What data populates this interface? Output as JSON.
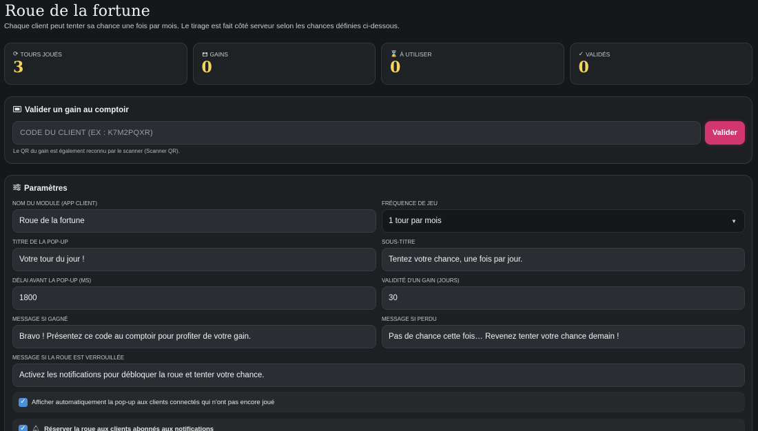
{
  "header": {
    "title": "Roue de la fortune",
    "subtitle": "Chaque client peut tenter sa chance une fois par mois. Le tirage est fait côté serveur selon les chances définies ci-dessous."
  },
  "stats": [
    {
      "icon": "refresh-icon",
      "label": "TOURS JOUÉS",
      "value": "3"
    },
    {
      "icon": "gift-icon",
      "label": "GAINS",
      "value": "0"
    },
    {
      "icon": "hourglass-icon",
      "label": "À UTILISER",
      "value": "0"
    },
    {
      "icon": "check-icon",
      "label": "VALIDÉS",
      "value": "0"
    }
  ],
  "validate": {
    "title": "Valider un gain au comptoir",
    "placeholder": "CODE DU CLIENT (EX : K7M2PQXR)",
    "button": "Valider",
    "hint": "Le QR du gain est également reconnu par le scanner (Scanner QR)."
  },
  "params": {
    "title": "Paramètres",
    "module_name_label": "NOM DU MODULE (APP CLIENT)",
    "module_name_value": "Roue de la fortune",
    "frequency_label": "FRÉQUENCE DE JEU",
    "frequency_value": "1 tour par mois",
    "popup_title_label": "TITRE DE LA POP-UP",
    "popup_title_value": "Votre tour du jour !",
    "subtitle_label": "SOUS-TITRE",
    "subtitle_value": "Tentez votre chance, une fois par jour.",
    "delay_label": "DÉLAI AVANT LA POP-UP (MS)",
    "delay_value": "1800",
    "validity_label": "VALIDITÉ D'UN GAIN (JOURS)",
    "validity_value": "30",
    "win_label": "MESSAGE SI GAGNÉ",
    "win_value": "Bravo ! Présentez ce code au comptoir pour profiter de votre gain.",
    "lose_label": "MESSAGE SI PERDU",
    "lose_value": "Pas de chance cette fois… Revenez tenter votre chance demain !",
    "locked_label": "MESSAGE SI LA ROUE EST VERROUILLÉE",
    "locked_value": "Activez les notifications pour débloquer la roue et tenter votre chance.",
    "auto_popup_label": "Afficher automatiquement la pop-up aux clients connectés qui n'ont pas encore joué",
    "reserve_label": "Réserver la roue aux clients abonnés aux notifications"
  },
  "colors": {
    "accent": "#d1376e",
    "stat_value": "#f4d35e",
    "checkbox": "#4c8fdb"
  }
}
